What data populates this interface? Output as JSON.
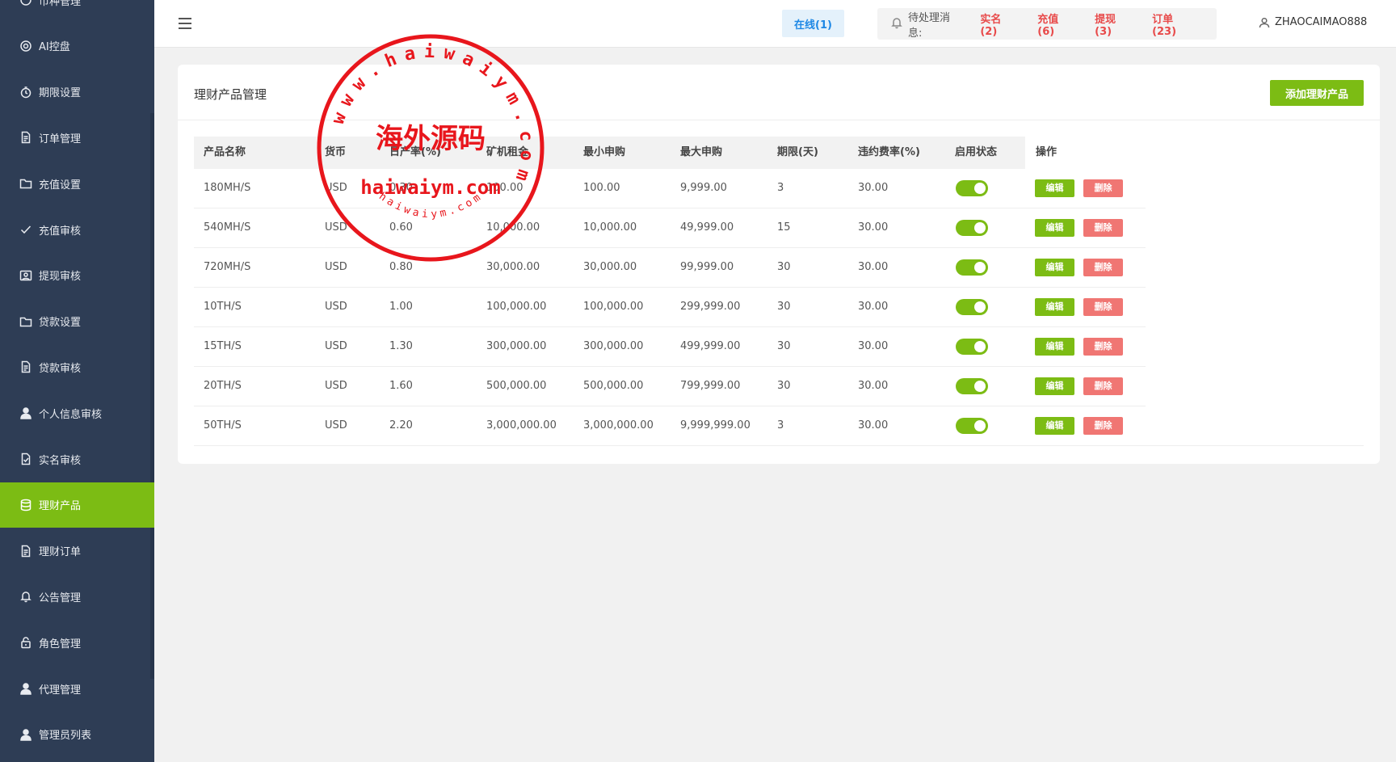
{
  "sidebar": {
    "items": [
      {
        "label": "币种管理",
        "icon": "coin-icon"
      },
      {
        "label": "AI控盘",
        "icon": "gear-icon"
      },
      {
        "label": "期限设置",
        "icon": "timer-icon"
      },
      {
        "label": "订单管理",
        "icon": "document-icon"
      },
      {
        "label": "充值设置",
        "icon": "folder-icon"
      },
      {
        "label": "充值审核",
        "icon": "check-icon"
      },
      {
        "label": "提现审核",
        "icon": "image-icon"
      },
      {
        "label": "贷款设置",
        "icon": "folder-icon"
      },
      {
        "label": "贷款审核",
        "icon": "document-icon"
      },
      {
        "label": "个人信息审核",
        "icon": "user-icon"
      },
      {
        "label": "实名审核",
        "icon": "document-check-icon"
      },
      {
        "label": "理财产品",
        "icon": "database-icon",
        "active": true
      },
      {
        "label": "理财订单",
        "icon": "document-icon"
      },
      {
        "label": "公告管理",
        "icon": "bell-icon"
      },
      {
        "label": "角色管理",
        "icon": "lock-icon"
      },
      {
        "label": "代理管理",
        "icon": "user-icon"
      },
      {
        "label": "管理员列表",
        "icon": "user-icon"
      }
    ]
  },
  "header": {
    "online": "在线(1)",
    "pending_label": "待处理消息:",
    "pending": [
      "实名(2)",
      "充值(6)",
      "提现(3)",
      "订单(23)"
    ],
    "username": "ZHAOCAIMAO888"
  },
  "card": {
    "title": "理财产品管理",
    "add_button": "添加理财产品"
  },
  "table": {
    "headers": [
      "产品名称",
      "货币",
      "日产率(%)",
      "矿机租金",
      "最小申购",
      "最大申购",
      "期限(天)",
      "违约费率(%)",
      "启用状态",
      "操作"
    ],
    "edit_label": "编辑",
    "delete_label": "删除",
    "rows": [
      [
        "180MH/S",
        "USD",
        "0.30",
        "100.00",
        "100.00",
        "9,999.00",
        "3",
        "30.00"
      ],
      [
        "540MH/S",
        "USD",
        "0.60",
        "10,000.00",
        "10,000.00",
        "49,999.00",
        "15",
        "30.00"
      ],
      [
        "720MH/S",
        "USD",
        "0.80",
        "30,000.00",
        "30,000.00",
        "99,999.00",
        "30",
        "30.00"
      ],
      [
        "10TH/S",
        "USD",
        "1.00",
        "100,000.00",
        "100,000.00",
        "299,999.00",
        "30",
        "30.00"
      ],
      [
        "15TH/S",
        "USD",
        "1.30",
        "300,000.00",
        "300,000.00",
        "499,999.00",
        "30",
        "30.00"
      ],
      [
        "20TH/S",
        "USD",
        "1.60",
        "500,000.00",
        "500,000.00",
        "799,999.00",
        "30",
        "30.00"
      ],
      [
        "50TH/S",
        "USD",
        "2.20",
        "3,000,000.00",
        "3,000,000.00",
        "9,999,999.00",
        "3",
        "30.00"
      ]
    ],
    "enabled": [
      true,
      true,
      true,
      true,
      true,
      true,
      true
    ]
  },
  "stamp": {
    "ring_text": "www.haiwaiym.com",
    "center_text": "海外源码",
    "domain_text": "haiwaiym.com",
    "bottom_text": "haiwaiym.com",
    "color": "#e8161c"
  }
}
